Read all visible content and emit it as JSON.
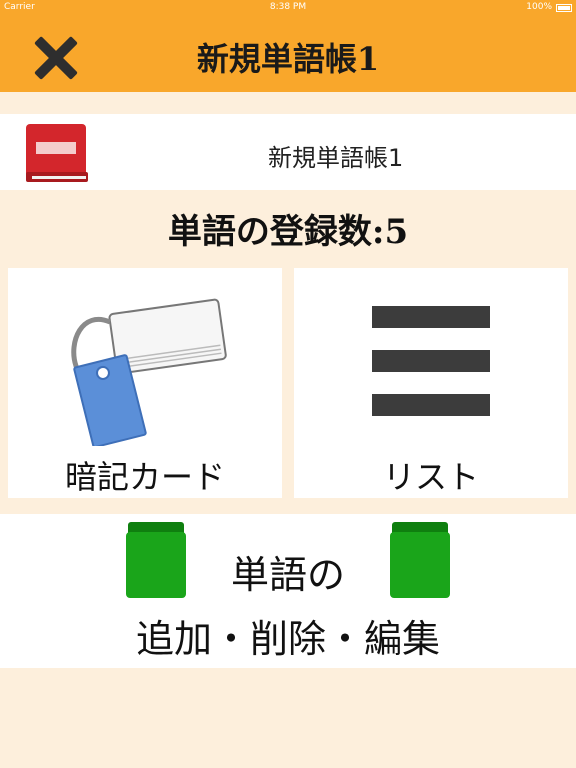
{
  "status_bar": {
    "carrier": "Carrier",
    "time": "8:38 PM",
    "battery": "100%"
  },
  "nav": {
    "title": "新規単語帳1"
  },
  "wordbook": {
    "name": "新規単語帳1"
  },
  "count": {
    "label": "単語の登録数:5"
  },
  "tiles": {
    "flashcard_label": "暗記カード",
    "list_label": "リスト"
  },
  "add_section": {
    "line1": "単語の",
    "line2": "追加・削除・編集"
  },
  "colors": {
    "header": "#f9a72b",
    "background": "#fdefdc",
    "book_red": "#d3262c",
    "book_green": "#1aa51a",
    "card_blue": "#5b8fd8"
  },
  "icons": {
    "close": "close-icon",
    "book": "red-book-icon",
    "flashcards": "flashcard-ring-icon",
    "list": "list-lines-icon",
    "green_book": "green-book-icon"
  }
}
